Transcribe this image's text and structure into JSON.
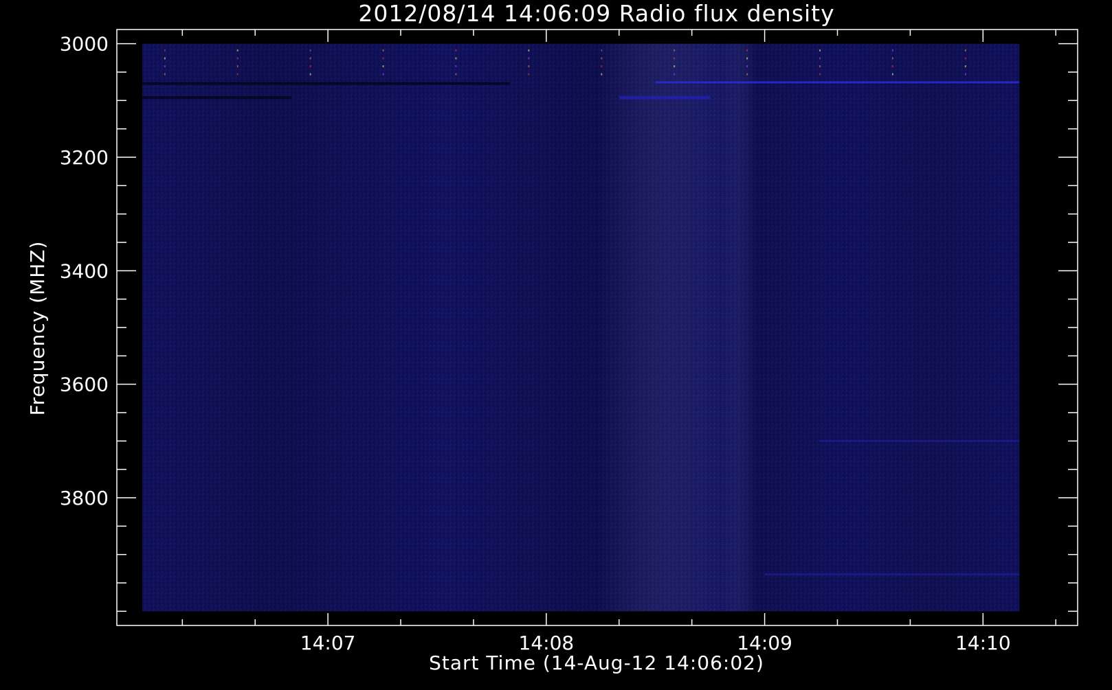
{
  "chart_data": {
    "type": "heatmap",
    "title": "2012/08/14 14:06:09 Radio flux density",
    "xlabel": "Start Time (14-Aug-12 14:06:02)",
    "ylabel": "Frequency (MHZ)",
    "x_ticks": [
      "14:07",
      "14:08",
      "14:09",
      "14:10"
    ],
    "y_ticks": [
      "3000",
      "3200",
      "3400",
      "3600",
      "3800"
    ],
    "x_range": [
      "14:06:02",
      "14:10:26"
    ],
    "x_data_extent": [
      "14:06:09",
      "14:10:10"
    ],
    "y_range_mhz": [
      2975,
      4025
    ],
    "y_data_extent_mhz": [
      3000,
      4000
    ],
    "y_reversed": true,
    "x_minor_interval_seconds": 20,
    "y_minor_interval_mhz": 50,
    "colormap": [
      "#000000",
      "#10106a",
      "#2a2ad0",
      "#ff3030",
      "#ffff60",
      "#ffffff"
    ],
    "background_level_color": "#10105e",
    "notable_features": [
      {
        "type": "dark horizontal band",
        "frequency_mhz": 3070,
        "from": "14:06:09",
        "to": "14:07:50"
      },
      {
        "type": "bright horizontal band",
        "frequency_mhz": 3068,
        "from": "14:08:30",
        "to": "14:10:10"
      },
      {
        "type": "dark horizontal band",
        "frequency_mhz": 3095,
        "from": "14:06:09",
        "to": "14:06:50"
      },
      {
        "type": "bright patch",
        "frequency_mhz": 3095,
        "from": "14:08:20",
        "to": "14:08:45"
      },
      {
        "type": "faint horizontal band",
        "frequency_mhz": 3935,
        "from": "14:09:00",
        "to": "14:10:10"
      },
      {
        "type": "faint horizontal band",
        "frequency_mhz": 3700,
        "from": "14:09:15",
        "to": "14:10:10"
      },
      {
        "type": "periodic speckles",
        "frequency_range_mhz": [
          3010,
          3055
        ],
        "from": "14:06:15",
        "to": "14:10:10",
        "note": "sparse red/yellow pixels"
      }
    ]
  },
  "colors": {
    "background": "#000000",
    "axes": "#ffffff",
    "text": "#ffffff",
    "data_base": "#12125f"
  }
}
